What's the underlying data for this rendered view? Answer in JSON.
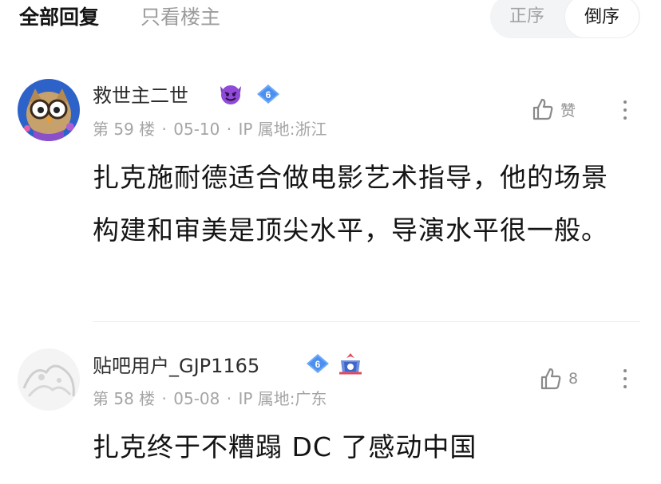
{
  "filter_tabs": {
    "all_replies": "全部回复",
    "only_op": "只看楼主"
  },
  "sort": {
    "asc": "正序",
    "desc": "倒序",
    "selected": "倒序"
  },
  "comments": [
    {
      "username": "救世主二世",
      "level": "6",
      "floor": "第 59 楼",
      "date": "05-10",
      "ip": "IP 属地:浙江",
      "text": "扎克施耐德适合做电影艺术指导，他的场景构建和审美是顶尖水平，导演水平很一般。",
      "like_label": "赞",
      "icons": {
        "emoji": "smiling-devil-icon",
        "level": "level-badge-icon",
        "like": "thumbs-up-icon",
        "more": "more-vertical-icon"
      }
    },
    {
      "username": "贴吧用户_GJP1165",
      "level": "6",
      "floor": "第 58 楼",
      "date": "05-08",
      "ip": "IP 属地:广东",
      "text": "扎克终于不糟蹋 DC 了感动中国",
      "like_label": "8",
      "icons": {
        "level": "level-badge-icon",
        "rank": "rank-crown-badge-icon",
        "like": "thumbs-up-icon",
        "more": "more-vertical-icon"
      }
    }
  ],
  "colors": {
    "level_badge": "#5b9cf5",
    "meta_text": "#a5a5a5",
    "toggle_bg": "#f3f4f6"
  }
}
